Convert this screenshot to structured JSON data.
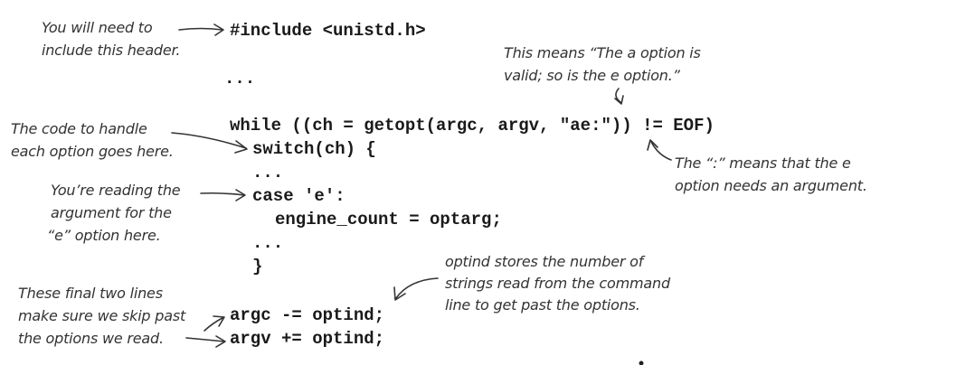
{
  "code_lines": {
    "include": "#include <unistd.h>",
    "ellipsis_top": "...",
    "while_line": "while ((ch = getopt(argc, argv, \"ae:\")) != EOF)",
    "switch_line": "switch(ch) {",
    "ellipsis_mid": "...",
    "case_line": "case 'e':",
    "assign_line": "engine_count = optarg;",
    "ellipsis_low": "...",
    "close_brace": "}",
    "argc_line": "argc -= optind;",
    "argv_line": "argv += optind;"
  },
  "annotations": {
    "header_note": [
      "You will need to",
      "include this header."
    ],
    "option_valid_note": [
      "This means “The a option is",
      "valid; so is the e option.”"
    ],
    "handle_note": [
      "The code to handle",
      "each option goes here."
    ],
    "colon_note": [
      "The “:” means that the e",
      "option needs an argument."
    ],
    "reading_note": [
      "You’re reading the",
      "argument for the",
      "“e” option here."
    ],
    "optind_note": [
      "optind stores the number of",
      "strings read from the command",
      "line to get past the options."
    ],
    "final_note": [
      "These final two lines",
      "make sure we skip past",
      "the options we read."
    ]
  },
  "colors": {
    "ink": "#333333",
    "code": "#1a1a1a",
    "background": "#ffffff"
  }
}
